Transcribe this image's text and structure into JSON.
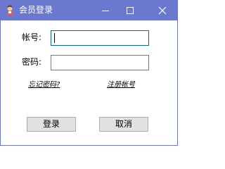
{
  "window": {
    "title": "会员登录",
    "app_icon": "user-avatar-icon",
    "controls": {
      "minimize": "minimize-icon",
      "maximize": "maximize-icon",
      "close": "close-icon"
    },
    "accent_color": "#6b78cf"
  },
  "form": {
    "account_label": "帐号:",
    "account_value": "",
    "password_label": "密码:",
    "password_value": ""
  },
  "links": {
    "forgot_password": "忘记密码?",
    "register": "注册帐号"
  },
  "buttons": {
    "login": "登录",
    "cancel": "取消"
  }
}
